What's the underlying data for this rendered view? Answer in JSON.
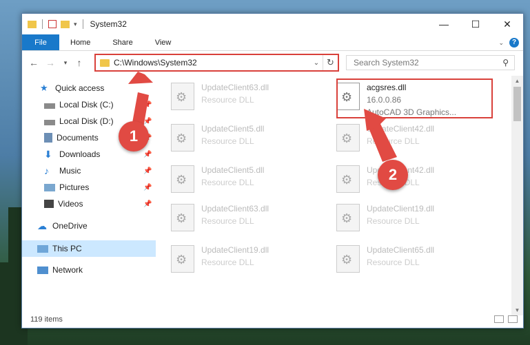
{
  "window": {
    "title": "System32",
    "buttons": {
      "minimize": "—",
      "maximize": "☐",
      "close": "✕"
    }
  },
  "ribbon": {
    "tabs": [
      "File",
      "Home",
      "Share",
      "View"
    ],
    "help": "?"
  },
  "address": {
    "path": "C:\\Windows\\System32",
    "search_placeholder": "Search System32"
  },
  "nav": {
    "items": [
      {
        "label": "Quick access",
        "icon": "star-icon"
      },
      {
        "label": "Local Disk (C:)",
        "icon": "drive-icon"
      },
      {
        "label": "Local Disk (D:)",
        "icon": "drive-icon"
      },
      {
        "label": "Documents",
        "icon": "document-icon"
      },
      {
        "label": "Downloads",
        "icon": "download-icon"
      },
      {
        "label": "Music",
        "icon": "music-icon"
      },
      {
        "label": "Pictures",
        "icon": "picture-icon"
      },
      {
        "label": "Videos",
        "icon": "video-icon"
      },
      {
        "label": "OneDrive",
        "icon": "cloud-icon"
      },
      {
        "label": "This PC",
        "icon": "computer-icon"
      },
      {
        "label": "Network",
        "icon": "network-icon"
      }
    ]
  },
  "files": [
    {
      "name": "UpdateClient63.dll",
      "type": "Resource DLL"
    },
    {
      "name": "acgsres.dll",
      "version": "16.0.0.86",
      "type": "AutoCAD 3D Graphics..."
    },
    {
      "name": "UpdateClient5.dll",
      "type": "Resource DLL"
    },
    {
      "name": "UpdateClient42.dll",
      "type": "Resource DLL"
    },
    {
      "name": "UpdateClient5.dll",
      "type": "Resource DLL"
    },
    {
      "name": "UpdateClient42.dll",
      "type": "Resource DLL"
    },
    {
      "name": "UpdateClient63.dll",
      "type": "Resource DLL"
    },
    {
      "name": "UpdateClient19.dll",
      "type": "Resource DLL"
    },
    {
      "name": "UpdateClient19.dll",
      "type": "Resource DLL"
    },
    {
      "name": "UpdateClient65.dll",
      "type": "Resource DLL"
    }
  ],
  "status": {
    "item_count": "119 items"
  },
  "callouts": {
    "one": "1",
    "two": "2"
  },
  "colors": {
    "accent": "#1979ca",
    "highlight": "#d9403a",
    "selected": "#cce8ff"
  }
}
